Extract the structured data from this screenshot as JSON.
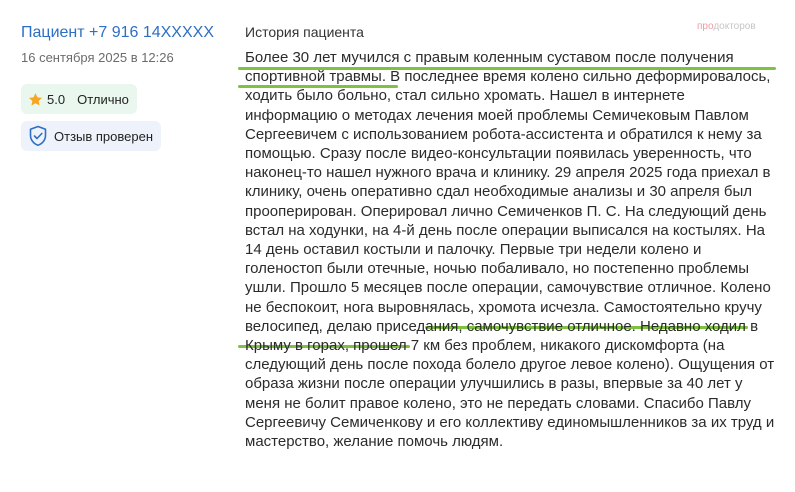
{
  "author": {
    "name": "Пациент +7 916 14XXXXX",
    "date": "16 сентября 2025 в 12:26"
  },
  "rating": {
    "value": "5.0",
    "label": "Отлично",
    "icon": "star-icon",
    "star_color": "#f5a623"
  },
  "verification": {
    "label": "Отзыв проверен",
    "icon": "shield-check-icon"
  },
  "section": {
    "title": "История пациента"
  },
  "brand": {
    "logo_pre": "про",
    "logo_post": "докторов"
  },
  "review": {
    "highlight_color": "#7fc241",
    "p1": "Более 30 лет мучился с правым коленным суставом после получения спортивной травмы.",
    "p2": " В последнее время колено сильно деформировалось, ходить было больно, стал сильно хромать. Нашел в интернете информацию о методах лечения моей проблемы Семичековым Павлом Сергеевичем с использованием робота-ассистента и обратился к нему за помощью. Сразу после видео-консультации появилась уверенность, что наконец-то нашел нужного врача и клинику. 29 апреля 2025 года приехал в клинику, очень оперативно сдал необходимые анализы и 30 апреля был прооперирован. Оперировал лично Семиченков П. С. На следующий день встал на ходунки, на 4-й день после операции выписался на костылях. На 14 день оставил костыли и палочку. Первые три недели колено и голеностоп были отечные, ночью побаливало, но постепенно проблемы ушли. Прошло 5 месяцев после операции, самочувствие отличное.",
    "p3": " Колено не беспокоит, нога выровнялась, хромота исчезла.",
    "p4": " Самостоятельно кручу велосипед, делаю приседания, самочувствие отличное. Недавно ходил в Крыму в горах, прошел 7 км без проблем, никакого дискомфорта (на следующий день после похода болело другое левое колено). Ощущения от образа жизни после операции улучшились в разы, впервые за 40 лет у меня не болит правое колено, это не передать словами. Спасибо Павлу Сергеевичу Семиченкову и его коллективу единомышленников за их труд и мастерство, желание помочь людям."
  }
}
